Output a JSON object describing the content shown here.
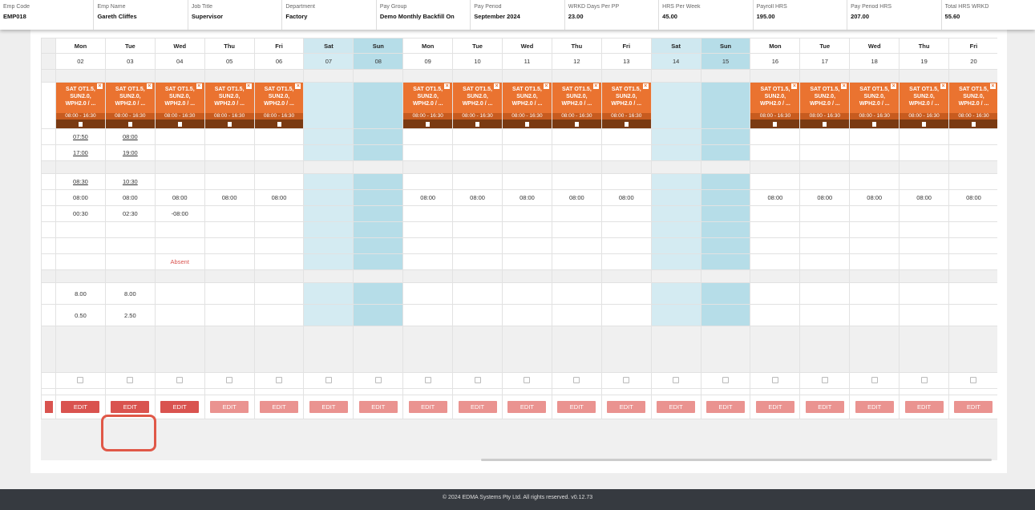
{
  "info": [
    {
      "label": "Emp Code",
      "value": "EMP018"
    },
    {
      "label": "Emp Name",
      "value": "Gareth Cliffes"
    },
    {
      "label": "Job Title",
      "value": "Supervisor"
    },
    {
      "label": "Department",
      "value": "Factory"
    },
    {
      "label": "Pay Group",
      "value": "Demo Monthly Backfill On"
    },
    {
      "label": "Pay Period",
      "value": "September 2024"
    },
    {
      "label": "WRKD Days Per PP",
      "value": "23.00"
    },
    {
      "label": "HRS Per Week",
      "value": "45.00"
    },
    {
      "label": "Payroll HRS",
      "value": "195.00"
    },
    {
      "label": "Pay Period HRS",
      "value": "207.00"
    },
    {
      "label": "Total HRS WRKD",
      "value": "55.60"
    }
  ],
  "days": [
    {
      "name": "Mon",
      "date": "02",
      "type": "work"
    },
    {
      "name": "Tue",
      "date": "03",
      "type": "work"
    },
    {
      "name": "Wed",
      "date": "04",
      "type": "work"
    },
    {
      "name": "Thu",
      "date": "05",
      "type": "work"
    },
    {
      "name": "Fri",
      "date": "06",
      "type": "work"
    },
    {
      "name": "Sat",
      "date": "07",
      "type": "sat"
    },
    {
      "name": "Sun",
      "date": "08",
      "type": "sun"
    },
    {
      "name": "Mon",
      "date": "09",
      "type": "work"
    },
    {
      "name": "Tue",
      "date": "10",
      "type": "work"
    },
    {
      "name": "Wed",
      "date": "11",
      "type": "work"
    },
    {
      "name": "Thu",
      "date": "12",
      "type": "work"
    },
    {
      "name": "Fri",
      "date": "13",
      "type": "work"
    },
    {
      "name": "Sat",
      "date": "14",
      "type": "sat"
    },
    {
      "name": "Sun",
      "date": "15",
      "type": "sun"
    },
    {
      "name": "Mon",
      "date": "16",
      "type": "work"
    },
    {
      "name": "Tue",
      "date": "17",
      "type": "work"
    },
    {
      "name": "Wed",
      "date": "18",
      "type": "work"
    },
    {
      "name": "Thu",
      "date": "19",
      "type": "work"
    },
    {
      "name": "Fri",
      "date": "20",
      "type": "work"
    }
  ],
  "shift": {
    "line1": "SAT OT1.5,",
    "line2": "SUN2.0,",
    "line3": "WPH2.0 / ...",
    "time": "08:00 - 16:30",
    "close": "×"
  },
  "clock_in": [
    "07:50",
    "08:00"
  ],
  "clock_out": [
    "17:00",
    "19:00"
  ],
  "break_times": [
    "08:30",
    "10:30"
  ],
  "scheduled": "08:00",
  "variance": [
    "00:30",
    "02:30",
    "-08:00"
  ],
  "absent_label": "Absent",
  "hours": [
    "8.00",
    "8.00"
  ],
  "overtime": [
    "0.50",
    "2.50"
  ],
  "edit_label": "EDIT",
  "footer": "© 2024 EDMA Systems Pty Ltd. All rights reserved. v0.12.73"
}
